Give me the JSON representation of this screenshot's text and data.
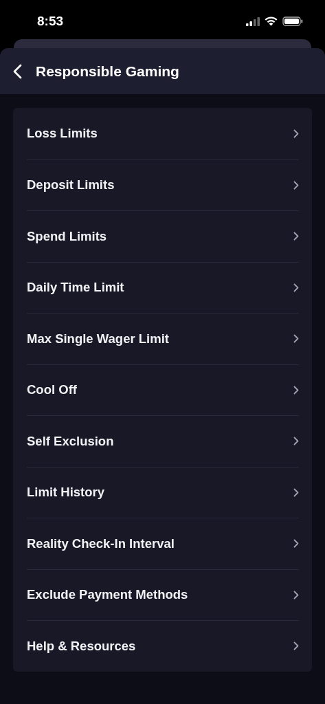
{
  "status_bar": {
    "time": "8:53"
  },
  "header": {
    "title": "Responsible Gaming"
  },
  "menu": {
    "items": [
      {
        "label": "Loss Limits"
      },
      {
        "label": "Deposit Limits"
      },
      {
        "label": "Spend Limits"
      },
      {
        "label": "Daily Time Limit"
      },
      {
        "label": "Max Single Wager Limit"
      },
      {
        "label": "Cool Off"
      },
      {
        "label": "Self Exclusion"
      },
      {
        "label": "Limit History"
      },
      {
        "label": "Reality Check-In Interval"
      },
      {
        "label": "Exclude Payment Methods"
      },
      {
        "label": "Help & Resources"
      }
    ]
  }
}
